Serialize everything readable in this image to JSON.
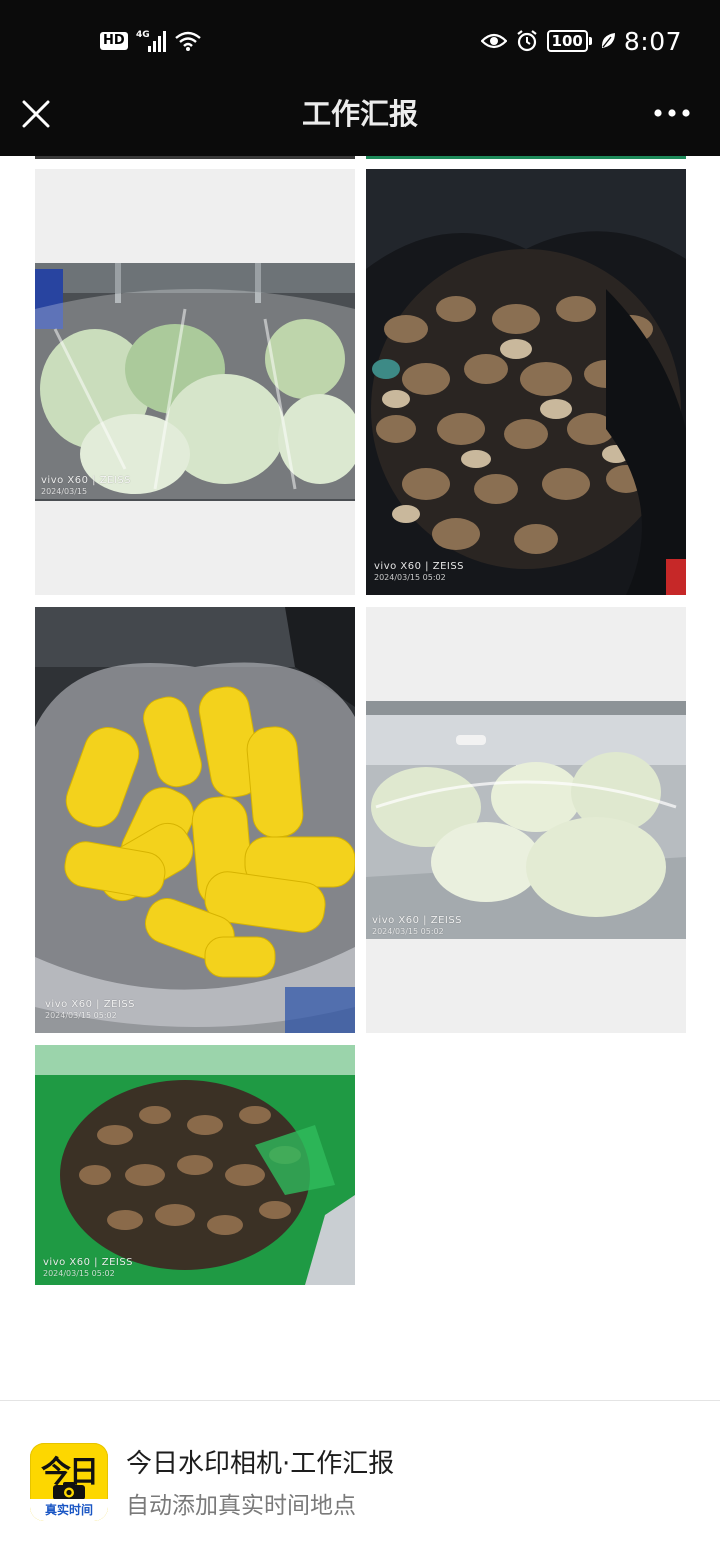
{
  "status_bar": {
    "left_badges": [
      "HD",
      "4G"
    ],
    "battery": "100",
    "time": "8:07",
    "icons": [
      "eye-icon",
      "alarm-icon",
      "battery-icon",
      "leaf-icon",
      "wifi-icon",
      "signal-icon"
    ]
  },
  "nav": {
    "title": "工作汇报",
    "close_icon": "close-icon",
    "more_icon": "more-icon"
  },
  "photos": [
    {
      "subject": "bagged cabbages",
      "watermark": "vivo X60 | ZEISS",
      "date": "2024/03/15"
    },
    {
      "subject": "shiitake mushrooms in black bag",
      "watermark": "vivo X60 | ZEISS",
      "date": "2024/03/15 05:02"
    },
    {
      "subject": "corn cobs in plastic bag",
      "watermark": "vivo X60 | ZEISS",
      "date": "2024/03/15 05:02"
    },
    {
      "subject": "napa cabbage on steel table",
      "watermark": "vivo X60 | ZEISS",
      "date": "2024/03/15 05:02"
    },
    {
      "subject": "ginger in green bag",
      "watermark": "vivo X60 | ZEISS",
      "date": "2024/03/15 05:02"
    }
  ],
  "banner": {
    "icon_big_text": "今日",
    "icon_strip_text": "真实时间",
    "title": "今日水印相机·工作汇报",
    "subtitle": "自动添加真实时间地点"
  },
  "colors": {
    "bar_bg": "#0b0b0b",
    "brand_yellow": "#fdd700",
    "brand_blue": "#1a56c4"
  }
}
